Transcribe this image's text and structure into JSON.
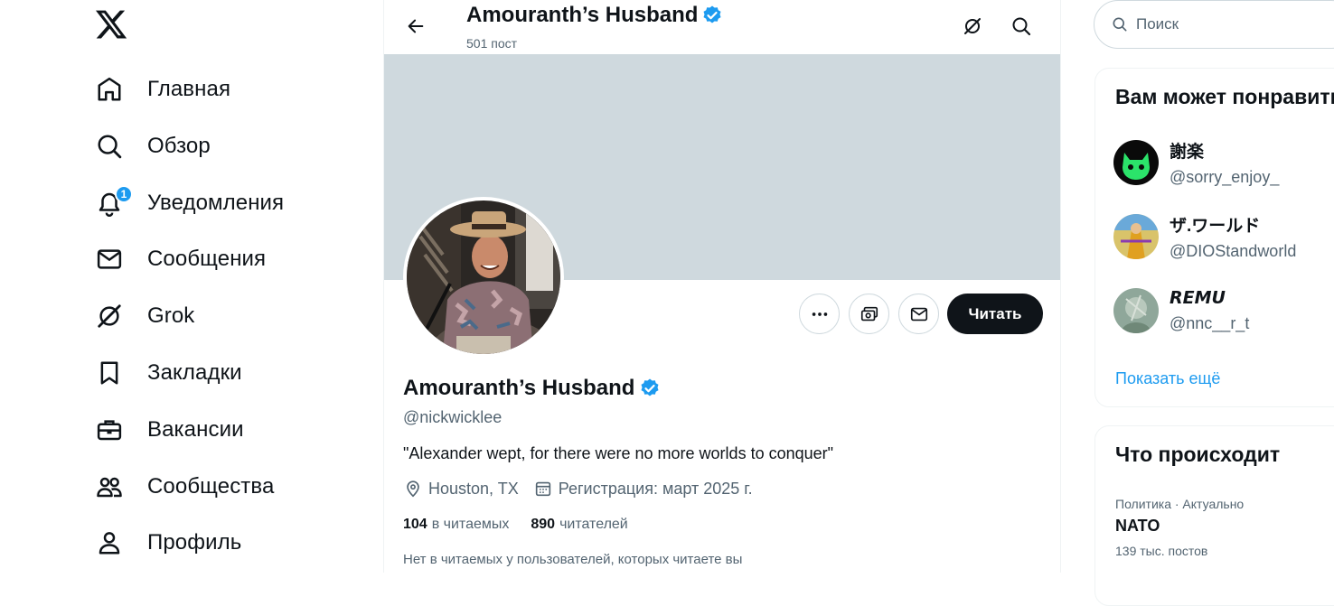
{
  "nav": {
    "items": [
      {
        "label": "Главная",
        "icon": "home-icon"
      },
      {
        "label": "Обзор",
        "icon": "search-icon"
      },
      {
        "label": "Уведомления",
        "icon": "bell-icon",
        "badge": "1"
      },
      {
        "label": "Сообщения",
        "icon": "mail-icon"
      },
      {
        "label": "Grok",
        "icon": "grok-icon"
      },
      {
        "label": "Закладки",
        "icon": "bookmark-icon"
      },
      {
        "label": "Вакансии",
        "icon": "briefcase-icon"
      },
      {
        "label": "Сообщества",
        "icon": "people-icon"
      },
      {
        "label": "Профиль",
        "icon": "person-icon"
      }
    ]
  },
  "header": {
    "name": "Amouranth’s Husband",
    "post_count": "501 пост"
  },
  "profile": {
    "name": "Amouranth’s Husband",
    "handle": "@nickwicklee",
    "bio": "\"Alexander wept, for there were no more worlds to conquer\"",
    "location": "Houston, TX",
    "joined": "Регистрация: март 2025 г.",
    "following_count": "104",
    "following_label": "в читаемых",
    "followers_count": "890",
    "followers_label": "читателей",
    "mutual_note": "Нет в читаемых у пользователей, которых читаете вы",
    "follow_button": "Читать"
  },
  "search": {
    "placeholder": "Поиск"
  },
  "suggestions": {
    "title": "Вам может понравиться",
    "users": [
      {
        "name": "謝楽",
        "handle": "@sorry_enjoy_"
      },
      {
        "name": "ザ.ワールド",
        "handle": "@DIOStandworld"
      },
      {
        "name": "𝙍𝙀𝙈𝙐",
        "handle": "@nnc__r_t"
      }
    ],
    "show_more": "Показать ещё"
  },
  "trends": {
    "title": "Что происходит",
    "items": [
      {
        "category": "Политика · Актуально",
        "name": "NATO",
        "count": "139 тыс. постов"
      }
    ]
  },
  "colors": {
    "accent": "#1d9bf0",
    "text": "#0f1419",
    "secondary": "#536471",
    "banner": "#cfd9de"
  }
}
